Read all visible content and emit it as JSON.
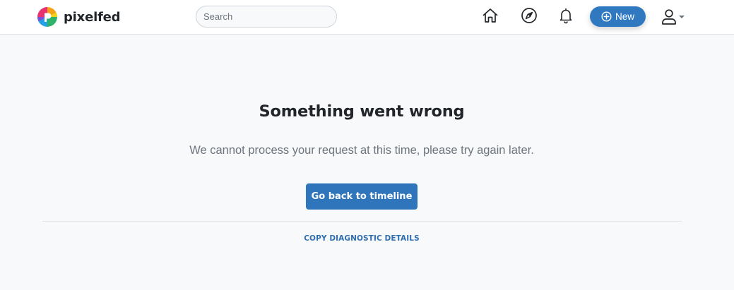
{
  "header": {
    "brand_name": "pixelfed",
    "search": {
      "placeholder": "Search"
    },
    "nav_icons": [
      "home-icon",
      "compass-icon",
      "bell-icon"
    ],
    "new_button_label": "New",
    "user_menu_icon": "user-icon"
  },
  "error": {
    "title": "Something went wrong",
    "message": "We cannot process your request at this time, please try again later.",
    "back_button_label": "Go back to timeline",
    "copy_link_label": "COPY DIAGNOSTIC DETAILS"
  },
  "colors": {
    "accent": "#3078c0",
    "page_background": "#f8f9fb",
    "navbar_background": "#ffffff"
  }
}
